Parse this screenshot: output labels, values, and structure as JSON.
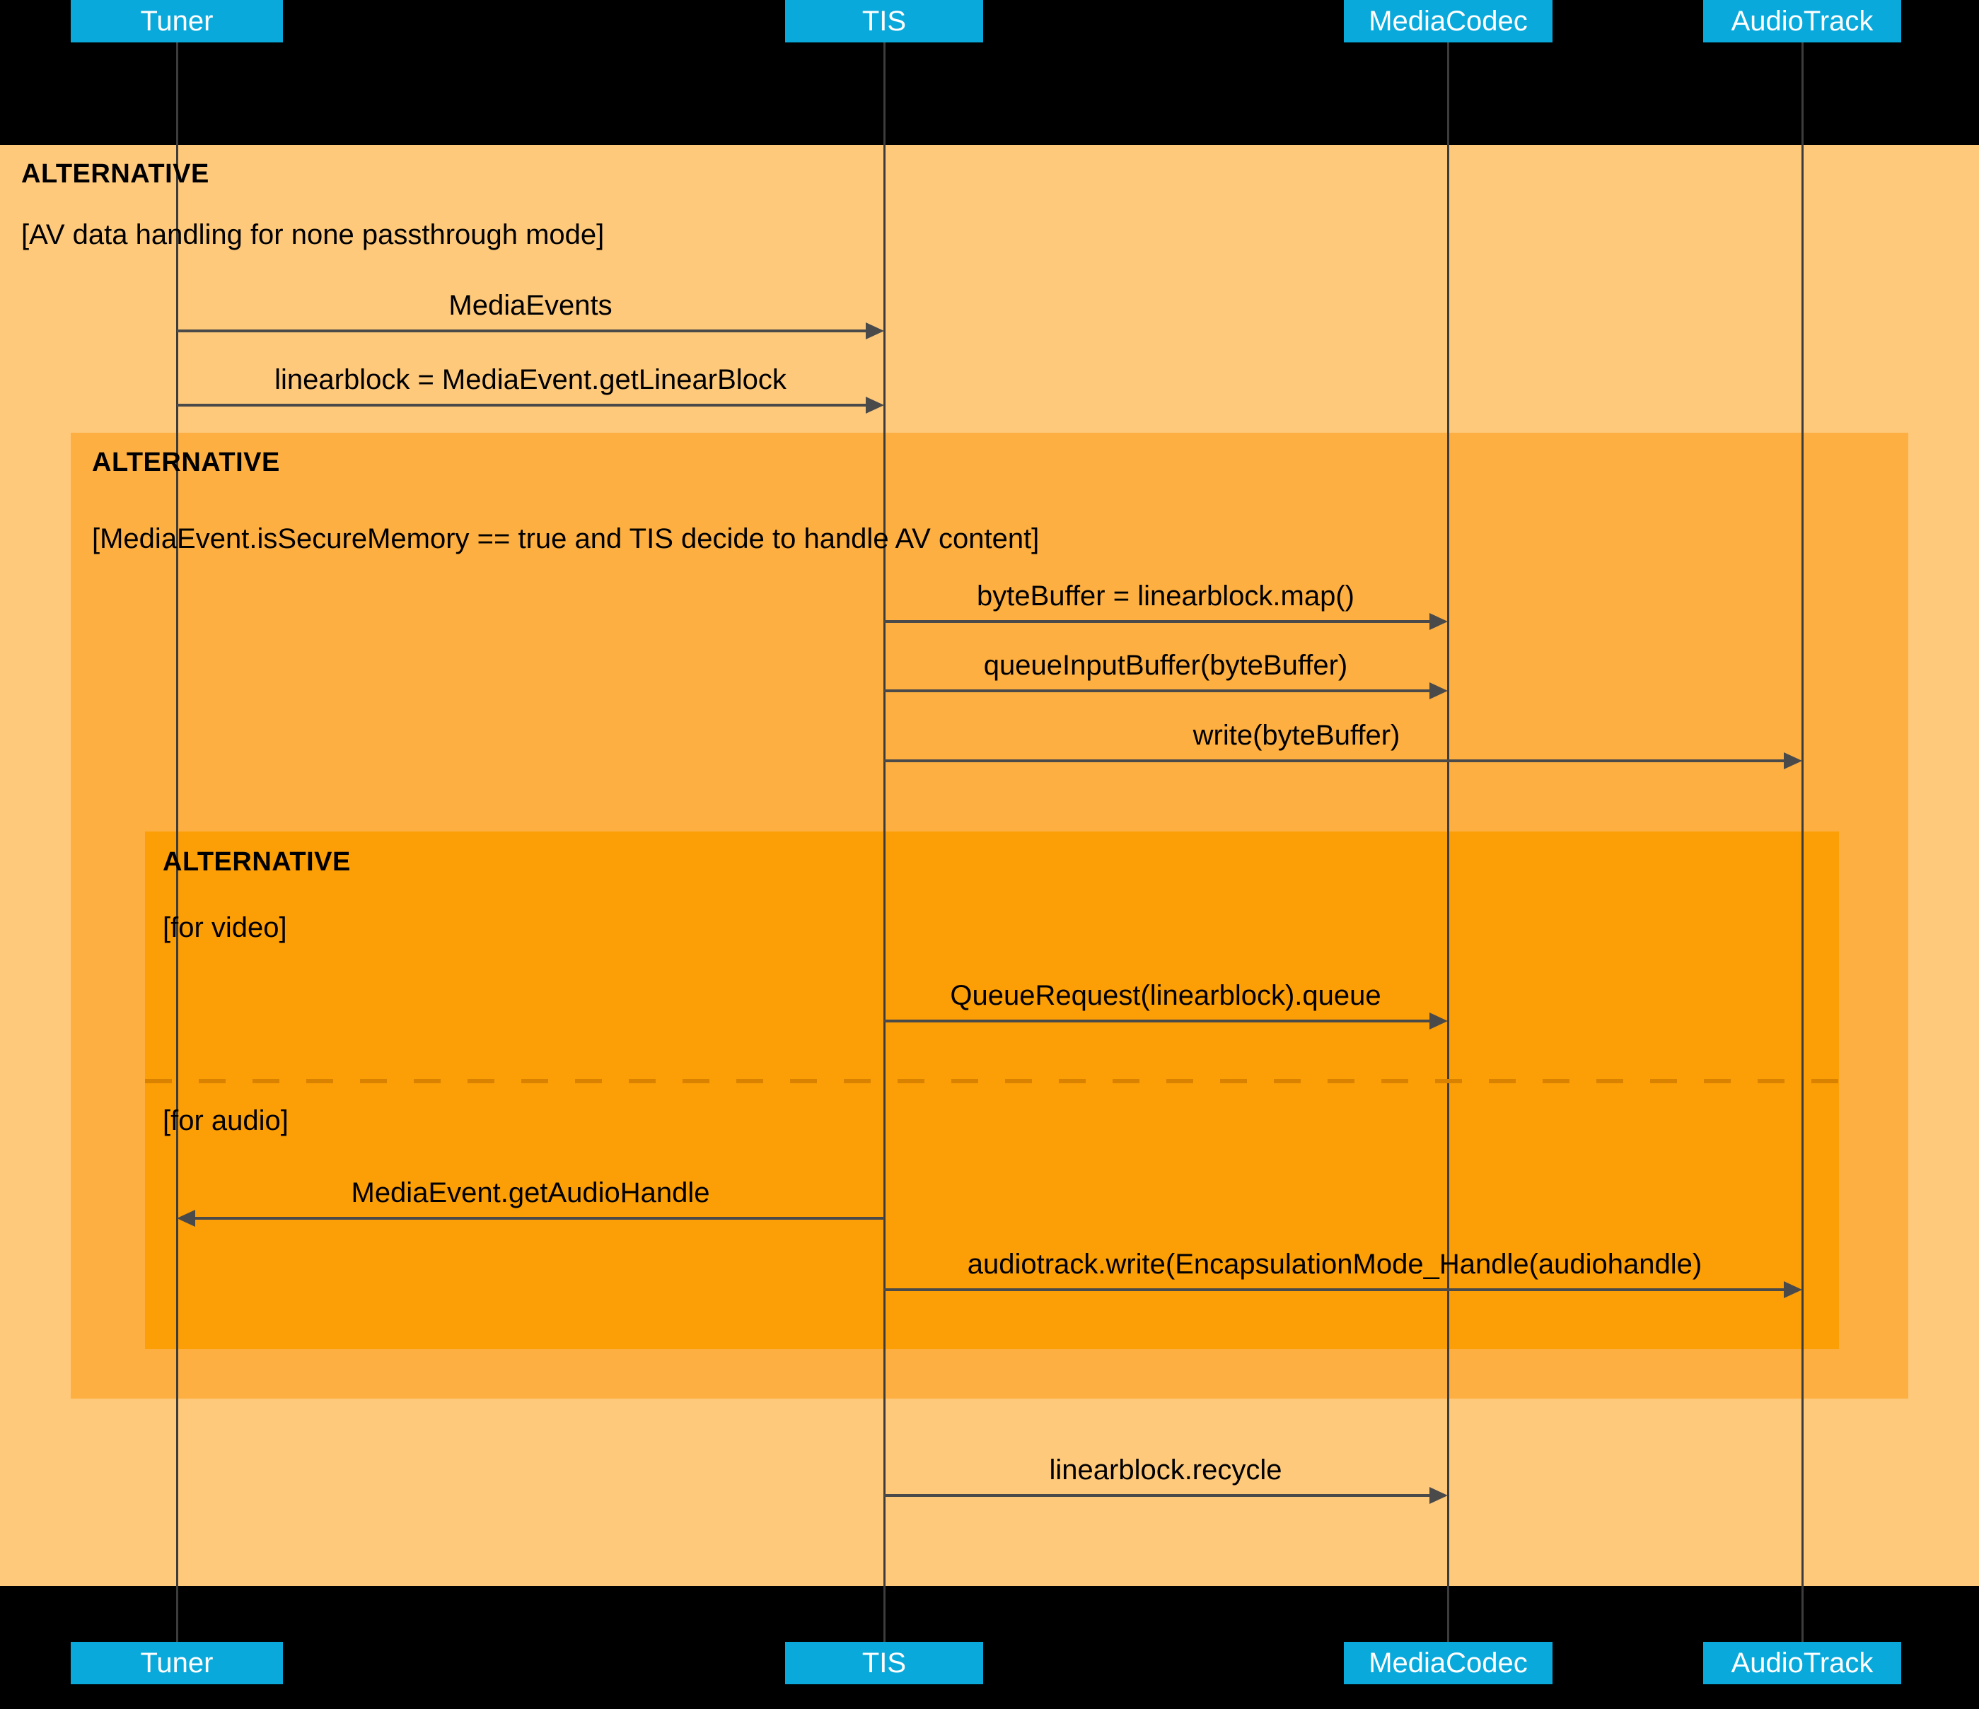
{
  "diagram": {
    "title": "AV data handling sequence",
    "colors": {
      "background": "#000000",
      "participant": "#09A9DB",
      "participant_text": "#FFFFFF",
      "frame_level1": "#FEC97B",
      "frame_level2": "#FDAF41",
      "frame_level3": "#FC9E06",
      "lifeline": "#3C3C3C",
      "arrow": "#4A4A4A",
      "divider": "#D98200"
    }
  },
  "participants": [
    {
      "id": "tuner",
      "label": "Tuner"
    },
    {
      "id": "tis",
      "label": "TIS"
    },
    {
      "id": "mediacodec",
      "label": "MediaCodec"
    },
    {
      "id": "audiotrack",
      "label": "AudioTrack"
    }
  ],
  "frames": [
    {
      "id": "alt-outer",
      "operator": "ALTERNATIVE",
      "guard": "[AV data handling for none passthrough mode]",
      "level": 1
    },
    {
      "id": "alt-secure",
      "operator": "ALTERNATIVE",
      "guard": "[MediaEvent.isSecureMemory == true and TIS decide to handle AV content]",
      "level": 2
    },
    {
      "id": "alt-av",
      "operator": "ALTERNATIVE",
      "guard": "[for video]",
      "guard_alt": "[for audio]",
      "level": 3
    }
  ],
  "messages": [
    {
      "id": "m1",
      "label": "MediaEvents",
      "from": "tuner",
      "to": "tis",
      "direction": "right"
    },
    {
      "id": "m2",
      "label": "linearblock = MediaEvent.getLinearBlock",
      "from": "tuner",
      "to": "tis",
      "direction": "right"
    },
    {
      "id": "m3",
      "label": "byteBuffer = linearblock.map()",
      "from": "tis",
      "to": "mediacodec",
      "direction": "right"
    },
    {
      "id": "m4",
      "label": "queueInputBuffer(byteBuffer)",
      "from": "tis",
      "to": "mediacodec",
      "direction": "right"
    },
    {
      "id": "m5",
      "label": "write(byteBuffer)",
      "from": "tis",
      "to": "audiotrack",
      "direction": "right"
    },
    {
      "id": "m6",
      "label": "QueueRequest(linearblock).queue",
      "from": "tis",
      "to": "mediacodec",
      "direction": "right"
    },
    {
      "id": "m7",
      "label": "MediaEvent.getAudioHandle",
      "from": "tis",
      "to": "tuner",
      "direction": "left"
    },
    {
      "id": "m8",
      "label": "audiotrack.write(EncapsulationMode_Handle(audiohandle)",
      "from": "tis",
      "to": "audiotrack",
      "direction": "right"
    },
    {
      "id": "m9",
      "label": "linearblock.recycle",
      "from": "tis",
      "to": "mediacodec",
      "direction": "right"
    }
  ]
}
